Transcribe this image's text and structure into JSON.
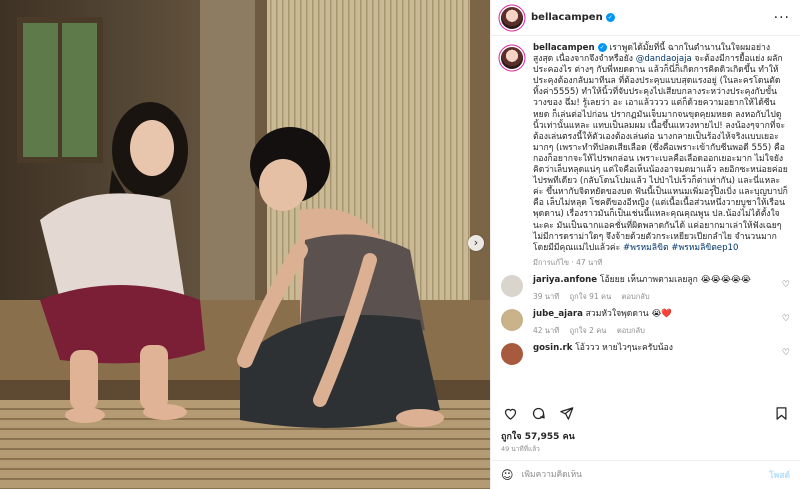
{
  "post": {
    "username": "bellacampen",
    "verified": true,
    "caption": {
      "part1": "เราพูดได้มั้ยที่นี้ ฉากในตำนานในใจผมอย่างสูงสุด เนื่องจากจึงจำหรือยัง ",
      "mention": "@dandaojaja",
      "part2": " จะต้องมีการยื้อแย่ง ผลักประคองไร ต่างๆ กับพี่หยดดาน แล้วก็นี่ก็เกิดการคิดดิวเกิดขึ้น ทำให้ประคุงต้องกลับมาทีนล ที่ต้องประคุบแบบสุดแรงอยู่ (ในละครโดนตัดทิ้งค่า5555) ทำให้นิ้วที่จับประคุงไปเสียบกลางระหว่างประคุงกับขั้นวางของ ฉึ่ม! รู้เลยว่า อะ เอาแล้วววว แต่ก็ด้วยความอยากให้ได้ซีนหยด ก็เล่นต่อไปก่อน ปรากฏมันเจ็บมากจนขุดคุยมหยด ลงหอกับไปดูนิ้วเท่านั้นแหละ แทบเป็นลมผม เนื้อขึ้นแหวงหายไป! ลงน้องๆจากที่จะต้องเล่นตรงนี้ให้ตัวเองต้องเล่นต่อ นางกลายเป็นร้องไห้จริงแบบเยอะมากๆ (เพราะทำทีปลดเสียเลือด (ซึ่งคือเพราะเข้ากับซีนพอดี 555) คือกองก็อยากจะให้ไปรพกล่อน เพราะเบลคือเลือดออกเยอะมาก ไม่ใจยังคิดว่าเล็บหลุดแน่ๆ แต่ใจคือเห็นน้องอาจมดมาแล้ว ลยอิกซะหน่อยค่อยไปรพทีเดียว (กลับโดนโปมแล้ว ไปป่าไปเร็วก็ต่าเท่ากัน) และนี่แหละค่ะ ขึ้นหากับจิตหยัดของบด ฟันนี้เป็นแหนมเพิ่มอรูป๊ิงเบิ่ง และบุญบาปก็คือ เล็บไม่หลุด โชคดีของอีหญิง (แต่เนื้อเนื้อส่วนหนึ่งวายบูชาให้เรือนพุดดาน) เรื่องราวมันก็เป็นเช่นนี้แหละคุณคุณพูน ปล.น้องไม่ได้ตั้งใจนะคะ มันเป็นฉากแอคชั่นที่ผิดพลาดกันได้ แค่อยากมาเล่าให้ฟังเฉยๆ ไม่มีการดราม่าใดๆ จึงจ้ายด้วยตัวกระเหยียวเปียกลำไย จำนวนมากโดยมีมีคุณแม่ไปแล้วค่ะ ",
      "hashtags": "#พรหมลิขิต #พรหมลิขิตep10"
    },
    "caption_meta": "มีการแก้ไข · 47 นาที",
    "comments": [
      {
        "username": "jariya.anfone",
        "text": "โอ้ยยย เห็นภาพตามเลยลูก",
        "emojis": "😭😭😭😭😭",
        "time": "39 นาที",
        "likes": "ถูกใจ 91 คน",
        "reply": "ตอบกลับ",
        "avatar_color": "#d9d4cc"
      },
      {
        "username": "jube_ajara",
        "text": "สวมหัวใจพุดดาน",
        "emojis": "😭❤️",
        "time": "42 นาที",
        "likes": "ถูกใจ 2 คน",
        "reply": "ตอบกลับ",
        "avatar_color": "#c9b28a"
      },
      {
        "username": "gosin.rk",
        "text": "โอ้ววว หายไวๆนะครับน้อง",
        "emojis": "",
        "time": "",
        "likes": "",
        "reply": "",
        "avatar_color": "#a85a3e"
      }
    ],
    "likes_count": "ถูกใจ 57,955 คน",
    "posted": "49 นาทีที่แล้ว",
    "add_comment_placeholder": "เพิ่มความคิดเห็น",
    "post_button": "โพสต์",
    "colors": {
      "accent": "#0095f6",
      "link": "#00376b",
      "muted": "#8e8e8e",
      "heart_red": "#ed4956"
    },
    "icons": [
      "heart-icon",
      "comment-icon",
      "share-icon",
      "bookmark-icon",
      "more-icon",
      "emoji-icon",
      "carousel-next-icon"
    ]
  }
}
